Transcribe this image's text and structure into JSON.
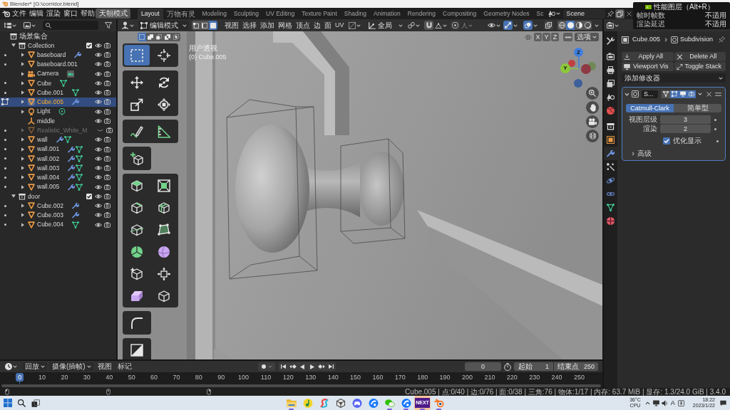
{
  "title_bar": {
    "title": "Blender* [G:\\corridor.blend]"
  },
  "top_bar": {
    "menus": [
      "文件",
      "编辑",
      "渲染",
      "窗口",
      "帮助"
    ],
    "mode_button": "天朝模式",
    "workspaces": [
      {
        "label": "Layout",
        "selected": true
      },
      {
        "label": "万物有灵",
        "selected": false
      },
      {
        "label": "Modeling",
        "selected": false
      },
      {
        "label": "Sculpting",
        "selected": false
      },
      {
        "label": "UV Editing",
        "selected": false
      },
      {
        "label": "Texture Paint",
        "selected": false
      },
      {
        "label": "Shading",
        "selected": false
      },
      {
        "label": "Animation",
        "selected": false
      },
      {
        "label": "Rendering",
        "selected": false
      },
      {
        "label": "Compositing",
        "selected": false
      },
      {
        "label": "Geometry Nodes",
        "selected": false
      },
      {
        "label": "Sc",
        "selected": false
      }
    ],
    "scene": "Scene"
  },
  "performance_overlay": {
    "title": "性能图层（Alt+R）",
    "rows": [
      {
        "label": "帧时帧数",
        "value": "不适用"
      },
      {
        "label": "渲染延迟",
        "value": "不适用"
      }
    ]
  },
  "outliner": {
    "tree": [
      {
        "name": "场景集合",
        "kind": "scene",
        "children": [
          {
            "name": "Collection",
            "kind": "collection",
            "expanded": true,
            "checked": true,
            "visible": true,
            "children": [
              {
                "name": "baseboard",
                "kind": "mesh",
                "editable": true,
                "editing": false,
                "expanded": false,
                "selected": false,
                "visible": true,
                "badges": [
                  {
                    "kind": "modifier"
                  }
                ]
              },
              {
                "name": "baseboard.001",
                "kind": "mesh",
                "editable": true,
                "editing": false,
                "expanded": false,
                "selected": false,
                "visible": true
              },
              {
                "name": "Camera",
                "kind": "camera",
                "editable": false,
                "editing": false,
                "expanded": false,
                "selected": false,
                "visible": true,
                "badges": [
                  {
                    "kind": "camera_data"
                  }
                ]
              },
              {
                "name": "Cube",
                "kind": "mesh",
                "editable": true,
                "editing": false,
                "expanded": false,
                "selected": false,
                "visible": true,
                "badges": [
                  {
                    "kind": "mesh_data"
                  }
                ]
              },
              {
                "name": "Cube.001",
                "kind": "mesh",
                "editable": true,
                "editing": false,
                "expanded": false,
                "selected": false,
                "visible": true,
                "badges": [
                  {
                    "kind": "mesh_data"
                  }
                ]
              },
              {
                "name": "Cube.005",
                "kind": "mesh",
                "editable": false,
                "editing": true,
                "expanded": false,
                "selected": true,
                "visible": true,
                "badges": [
                  {
                    "kind": "modifier"
                  }
                ]
              },
              {
                "name": "Light",
                "kind": "light",
                "editable": false,
                "editing": false,
                "expanded": false,
                "selected": false,
                "visible": true,
                "badges": [
                  {
                    "kind": "light_data"
                  }
                ]
              },
              {
                "name": "middle",
                "kind": "empty",
                "editable": false,
                "editing": false,
                "selected": false,
                "visible": true
              },
              {
                "name": "Realistic_White_M",
                "kind": "mesh",
                "editable": true,
                "editing": false,
                "expanded": false,
                "selected": false,
                "visible": false
              },
              {
                "name": "wall",
                "kind": "mesh",
                "editable": true,
                "editing": false,
                "expanded": false,
                "selected": false,
                "visible": true,
                "badges": [
                  {
                    "kind": "modifier"
                  },
                  {
                    "kind": "mesh_data"
                  }
                ]
              },
              {
                "name": "wall.001",
                "kind": "mesh",
                "editable": true,
                "editing": false,
                "expanded": false,
                "selected": false,
                "visible": true,
                "badges": [
                  {
                    "kind": "modifier"
                  },
                  {
                    "kind": "mesh_data"
                  }
                ]
              },
              {
                "name": "wall.002",
                "kind": "mesh",
                "editable": true,
                "editing": false,
                "expanded": false,
                "selected": false,
                "visible": true,
                "badges": [
                  {
                    "kind": "modifier"
                  },
                  {
                    "kind": "mesh_data"
                  }
                ]
              },
              {
                "name": "wall.003",
                "kind": "mesh",
                "editable": true,
                "editing": false,
                "expanded": false,
                "selected": false,
                "visible": true,
                "badges": [
                  {
                    "kind": "modifier"
                  },
                  {
                    "kind": "mesh_data"
                  }
                ]
              },
              {
                "name": "wall.004",
                "kind": "mesh",
                "editable": true,
                "editing": false,
                "expanded": false,
                "selected": false,
                "visible": true,
                "badges": [
                  {
                    "kind": "modifier"
                  },
                  {
                    "kind": "mesh_data"
                  }
                ]
              },
              {
                "name": "wall.005",
                "kind": "mesh",
                "editable": true,
                "editing": false,
                "expanded": false,
                "selected": false,
                "visible": true,
                "badges": [
                  {
                    "kind": "modifier"
                  },
                  {
                    "kind": "mesh_data"
                  }
                ]
              }
            ]
          },
          {
            "name": "door",
            "kind": "collection",
            "expanded": true,
            "checked": true,
            "visible": true,
            "children": [
              {
                "name": "Cube.002",
                "kind": "mesh",
                "editable": true,
                "editing": false,
                "expanded": false,
                "selected": false,
                "visible": true,
                "badges": [
                  {
                    "kind": "modifier"
                  }
                ]
              },
              {
                "name": "Cube.003",
                "kind": "mesh",
                "editable": true,
                "editing": false,
                "expanded": false,
                "selected": false,
                "visible": true,
                "badges": [
                  {
                    "kind": "modifier"
                  }
                ]
              },
              {
                "name": "Cube.004",
                "kind": "mesh",
                "editable": true,
                "editing": false,
                "expanded": false,
                "selected": false,
                "visible": true,
                "badges": [
                  {
                    "kind": "mesh_data"
                  }
                ]
              }
            ]
          }
        ]
      }
    ]
  },
  "viewport": {
    "header": {
      "mode": "编辑模式",
      "select_modes": [
        {
          "kind": "vertex",
          "selected": false
        },
        {
          "kind": "edge",
          "selected": false
        },
        {
          "kind": "face",
          "selected": true
        }
      ],
      "menus": [
        "视图",
        "选择",
        "添加",
        "网格",
        "顶点",
        "边",
        "面",
        "UV"
      ],
      "orientation": "全局",
      "toggles": [
        {
          "kind": "gizmo",
          "on": true
        },
        {
          "kind": "overlay",
          "on": true
        },
        {
          "kind": "xray",
          "on": false
        }
      ],
      "shading": [
        {
          "kind": "wireframe",
          "selected": false
        },
        {
          "kind": "solid",
          "selected": true
        },
        {
          "kind": "material",
          "selected": false
        },
        {
          "kind": "rendered",
          "selected": false
        }
      ]
    },
    "tool_header": {
      "select_ops": [
        {
          "kind": "set",
          "selected": true
        },
        {
          "kind": "extend",
          "selected": false
        },
        {
          "kind": "subtract",
          "selected": false
        },
        {
          "kind": "difference",
          "selected": false
        },
        {
          "kind": "intersect",
          "selected": false
        }
      ],
      "axes": [
        "X",
        "Y",
        "Z"
      ],
      "options": "选项"
    },
    "toolbar": [
      {
        "tools": [
          {
            "kind": "select",
            "selected": true
          },
          {
            "kind": "cursor",
            "selected": false
          }
        ]
      },
      {
        "tools": [
          {
            "kind": "move",
            "selected": false
          },
          {
            "kind": "rotate",
            "selected": false
          },
          {
            "kind": "scale",
            "selected": false
          },
          {
            "kind": "transform",
            "selected": false
          }
        ]
      },
      {
        "tools": [
          {
            "kind": "annotate",
            "selected": false
          },
          {
            "kind": "measure",
            "selected": false
          }
        ]
      },
      {
        "tools": [
          {
            "kind": "add_cube",
            "selected": false
          }
        ]
      },
      {
        "tools": [
          {
            "kind": "extrude",
            "selected": false
          },
          {
            "kind": "inset",
            "selected": false
          },
          {
            "kind": "bevel",
            "selected": false
          },
          {
            "kind": "loop_cut",
            "selected": false
          },
          {
            "kind": "knife",
            "selected": false
          },
          {
            "kind": "poly_build",
            "selected": false
          },
          {
            "kind": "spin",
            "selected": false
          },
          {
            "kind": "smooth",
            "selected": false
          },
          {
            "kind": "randomize",
            "selected": false
          },
          {
            "kind": "shrink",
            "selected": false
          },
          {
            "kind": "shear",
            "selected": false
          },
          {
            "kind": "to_sphere",
            "selected": false
          }
        ]
      },
      {
        "tools": [
          {
            "kind": "corner",
            "selected": false
          }
        ]
      },
      {
        "tools": [
          {
            "kind": "rip",
            "selected": false
          }
        ]
      }
    ],
    "info": [
      "用户透视",
      "(0) Cube.005"
    ],
    "gizmo": [
      {
        "kind": "end",
        "color": "#6f8a56"
      },
      {
        "kind": "end",
        "color": "#c0403f"
      },
      {
        "kind": "end",
        "color": "#8e3a45"
      },
      {
        "kind": "end",
        "color": "#3d5f9a"
      },
      {
        "kind": "axis",
        "label": "Z",
        "color": "#3f7fe0"
      },
      {
        "kind": "axis",
        "label": "Y",
        "color": "#8cc83a"
      }
    ]
  },
  "properties": {
    "tab_groups": [
      {
        "tabs": [
          {
            "kind": "tool",
            "selected": false
          }
        ]
      },
      {
        "tabs": [
          {
            "kind": "render",
            "selected": false
          },
          {
            "kind": "output",
            "selected": false
          },
          {
            "kind": "view_layer",
            "selected": false
          },
          {
            "kind": "scene",
            "selected": false
          },
          {
            "kind": "world",
            "selected": false
          }
        ]
      },
      {
        "tabs": [
          {
            "kind": "collection",
            "selected": false
          },
          {
            "kind": "object",
            "selected": false
          },
          {
            "kind": "modifiers",
            "selected": true
          },
          {
            "kind": "particles",
            "selected": false
          },
          {
            "kind": "physics",
            "selected": false
          },
          {
            "kind": "constraints",
            "selected": false
          },
          {
            "kind": "data",
            "selected": false
          },
          {
            "kind": "material",
            "selected": false
          }
        ]
      }
    ],
    "breadcrumb": [
      "Cube.005",
      "Subdivision"
    ],
    "actions": [
      {
        "kind": "apply",
        "label": "Apply All"
      },
      {
        "kind": "delete",
        "label": "Delete All"
      },
      {
        "kind": "viewport",
        "label": "Viewport Vis"
      },
      {
        "kind": "toggle",
        "label": "Toggle Stack"
      }
    ],
    "add_modifier": "添加修改器",
    "modifier": {
      "name": "S...",
      "expanded": true,
      "toggles": [
        {
          "kind": "edit_mode",
          "on": false
        },
        {
          "kind": "on_cage",
          "on": true
        },
        {
          "kind": "viewport",
          "on": true
        },
        {
          "kind": "render",
          "on": true
        }
      ],
      "types": [
        {
          "label": "Catmull-Clark",
          "selected": true
        },
        {
          "label": "简单型",
          "selected": false
        }
      ],
      "fields": [
        {
          "label": "视图层级",
          "value": "3"
        },
        {
          "label": "渲染",
          "value": "2"
        }
      ],
      "optimize": {
        "label": "优化显示",
        "checked": true
      },
      "advanced": {
        "label": "高级",
        "expanded": false
      }
    }
  },
  "timeline": {
    "menus": [
      {
        "kind": "dropdown",
        "label": "回放"
      },
      {
        "kind": "dropdown",
        "label": "摄像(插帧)"
      },
      {
        "kind": "menu",
        "label": "视图"
      },
      {
        "kind": "menu",
        "label": "标记"
      }
    ],
    "current_frame": "0",
    "start_label": "起始",
    "start": "1",
    "end_label": "结束点",
    "end": "250",
    "ruler": [
      {
        "label": "0",
        "selected": true
      },
      {
        "label": "10",
        "selected": false
      },
      {
        "label": "20",
        "selected": false
      },
      {
        "label": "30",
        "selected": false
      },
      {
        "label": "40",
        "selected": false
      },
      {
        "label": "50",
        "selected": false
      },
      {
        "label": "60",
        "selected": false
      },
      {
        "label": "70",
        "selected": false
      },
      {
        "label": "80",
        "selected": false
      },
      {
        "label": "90",
        "selected": false
      },
      {
        "label": "100",
        "selected": false
      },
      {
        "label": "110",
        "selected": false
      },
      {
        "label": "120",
        "selected": false
      },
      {
        "label": "130",
        "selected": false
      },
      {
        "label": "140",
        "selected": false
      },
      {
        "label": "150",
        "selected": false
      },
      {
        "label": "160",
        "selected": false
      },
      {
        "label": "170",
        "selected": false
      },
      {
        "label": "180",
        "selected": false
      },
      {
        "label": "190",
        "selected": false
      },
      {
        "label": "200",
        "selected": false
      },
      {
        "label": "210",
        "selected": false
      },
      {
        "label": "220",
        "selected": false
      },
      {
        "label": "230",
        "selected": false
      },
      {
        "label": "240",
        "selected": false
      },
      {
        "label": "250",
        "selected": false
      }
    ]
  },
  "status_bar": {
    "text": "Cube.005 | 点:0/40 | 边:0/76 | 面:0/38 | 三角:76 | 物体:1/17 | 内存: 63.7 MiB | 显存: 1.3/24.0 GiB | 3.4.0"
  },
  "taskbar": {
    "apps": [
      {
        "kind": "folder",
        "running": true,
        "active": false
      },
      {
        "kind": "music",
        "running": false,
        "active": false
      },
      {
        "kind": "swirl",
        "running": false,
        "active": false
      },
      {
        "kind": "cube",
        "running": false,
        "active": false
      },
      {
        "kind": "gamepad",
        "running": false,
        "active": false
      },
      {
        "kind": "swoosh",
        "running": false,
        "active": false
      },
      {
        "kind": "chat",
        "running": true,
        "active": false
      },
      {
        "kind": "swoosh",
        "running": true,
        "active": false
      },
      {
        "kind": "tile",
        "label": "NEXT",
        "running": true,
        "active": true
      },
      {
        "kind": "orbit",
        "running": true,
        "active": false
      }
    ],
    "tray": {
      "temperature": "36°C",
      "sensor": "CPU",
      "input_mode": "A",
      "time": "18:22",
      "date": "2023/1/22"
    }
  }
}
